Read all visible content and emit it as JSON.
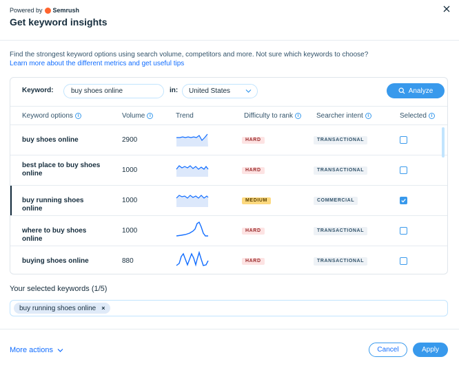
{
  "header": {
    "powered_by": "Powered by",
    "brand": "Semrush",
    "title": "Get keyword insights",
    "close_icon": "close-icon"
  },
  "intro": {
    "description": "Find the strongest keyword options using search volume, competitors and more. Not sure which keywords to choose?",
    "learn_more": "Learn more about the different metrics and get useful tips"
  },
  "search": {
    "keyword_label": "Keyword:",
    "keyword_value": "buy shoes online",
    "in_label": "in:",
    "country_value": "United States",
    "analyze_label": "Analyze",
    "analyze_icon": "search-icon"
  },
  "table": {
    "columns": [
      "Keyword options",
      "Volume",
      "Trend",
      "Difficulty to rank",
      "Searcher intent",
      "Selected"
    ],
    "rows": [
      {
        "keyword": "buy shoes online",
        "volume": "2900",
        "difficulty": "HARD",
        "intent": "TRANSACTIONAL",
        "selected": false
      },
      {
        "keyword": "best place to buy shoes online",
        "volume": "1000",
        "difficulty": "HARD",
        "intent": "TRANSACTIONAL",
        "selected": false
      },
      {
        "keyword": "buy running shoes online",
        "volume": "1000",
        "difficulty": "MEDIUM",
        "intent": "COMMERCIAL",
        "selected": true
      },
      {
        "keyword": "where to buy shoes online",
        "volume": "1000",
        "difficulty": "HARD",
        "intent": "TRANSACTIONAL",
        "selected": false
      },
      {
        "keyword": "buying shoes online",
        "volume": "880",
        "difficulty": "HARD",
        "intent": "TRANSACTIONAL",
        "selected": false
      }
    ]
  },
  "selected_keywords": {
    "title": "Your selected keywords (1/5)",
    "tags": [
      "buy running shoes online"
    ]
  },
  "footer": {
    "more_actions": "More actions",
    "cancel": "Cancel",
    "apply": "Apply"
  },
  "colors": {
    "accent": "#3899ec",
    "link": "#116dff",
    "hard_bg": "#fde3e3",
    "medium_bg": "#fdd97e",
    "brand": "#ff642d"
  }
}
